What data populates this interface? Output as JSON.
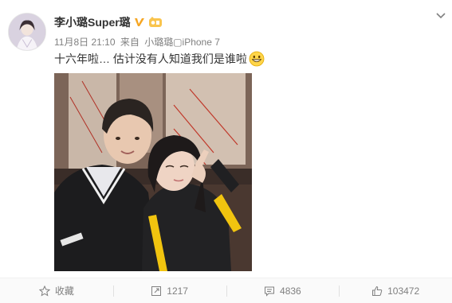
{
  "post": {
    "username": "李小璐Super璐",
    "date": "11月8日 21:10",
    "source_prefix": "来自",
    "source": "小璐璐▢iPhone 7",
    "text": "十六年啦… 估计没有人知道我们是谁啦"
  },
  "icons": {
    "verified": "verified-v-icon",
    "level": "member-level-icon",
    "emoji": "grinning-emoji-icon",
    "menu": "chevron-down-icon"
  },
  "actions": {
    "favorite_label": "收藏",
    "repost_count": "1217",
    "comment_count": "4836",
    "like_count": "103472"
  },
  "colors": {
    "verified": "#f6a623",
    "meta_text": "#808080",
    "footer_bg": "#fafafa"
  }
}
